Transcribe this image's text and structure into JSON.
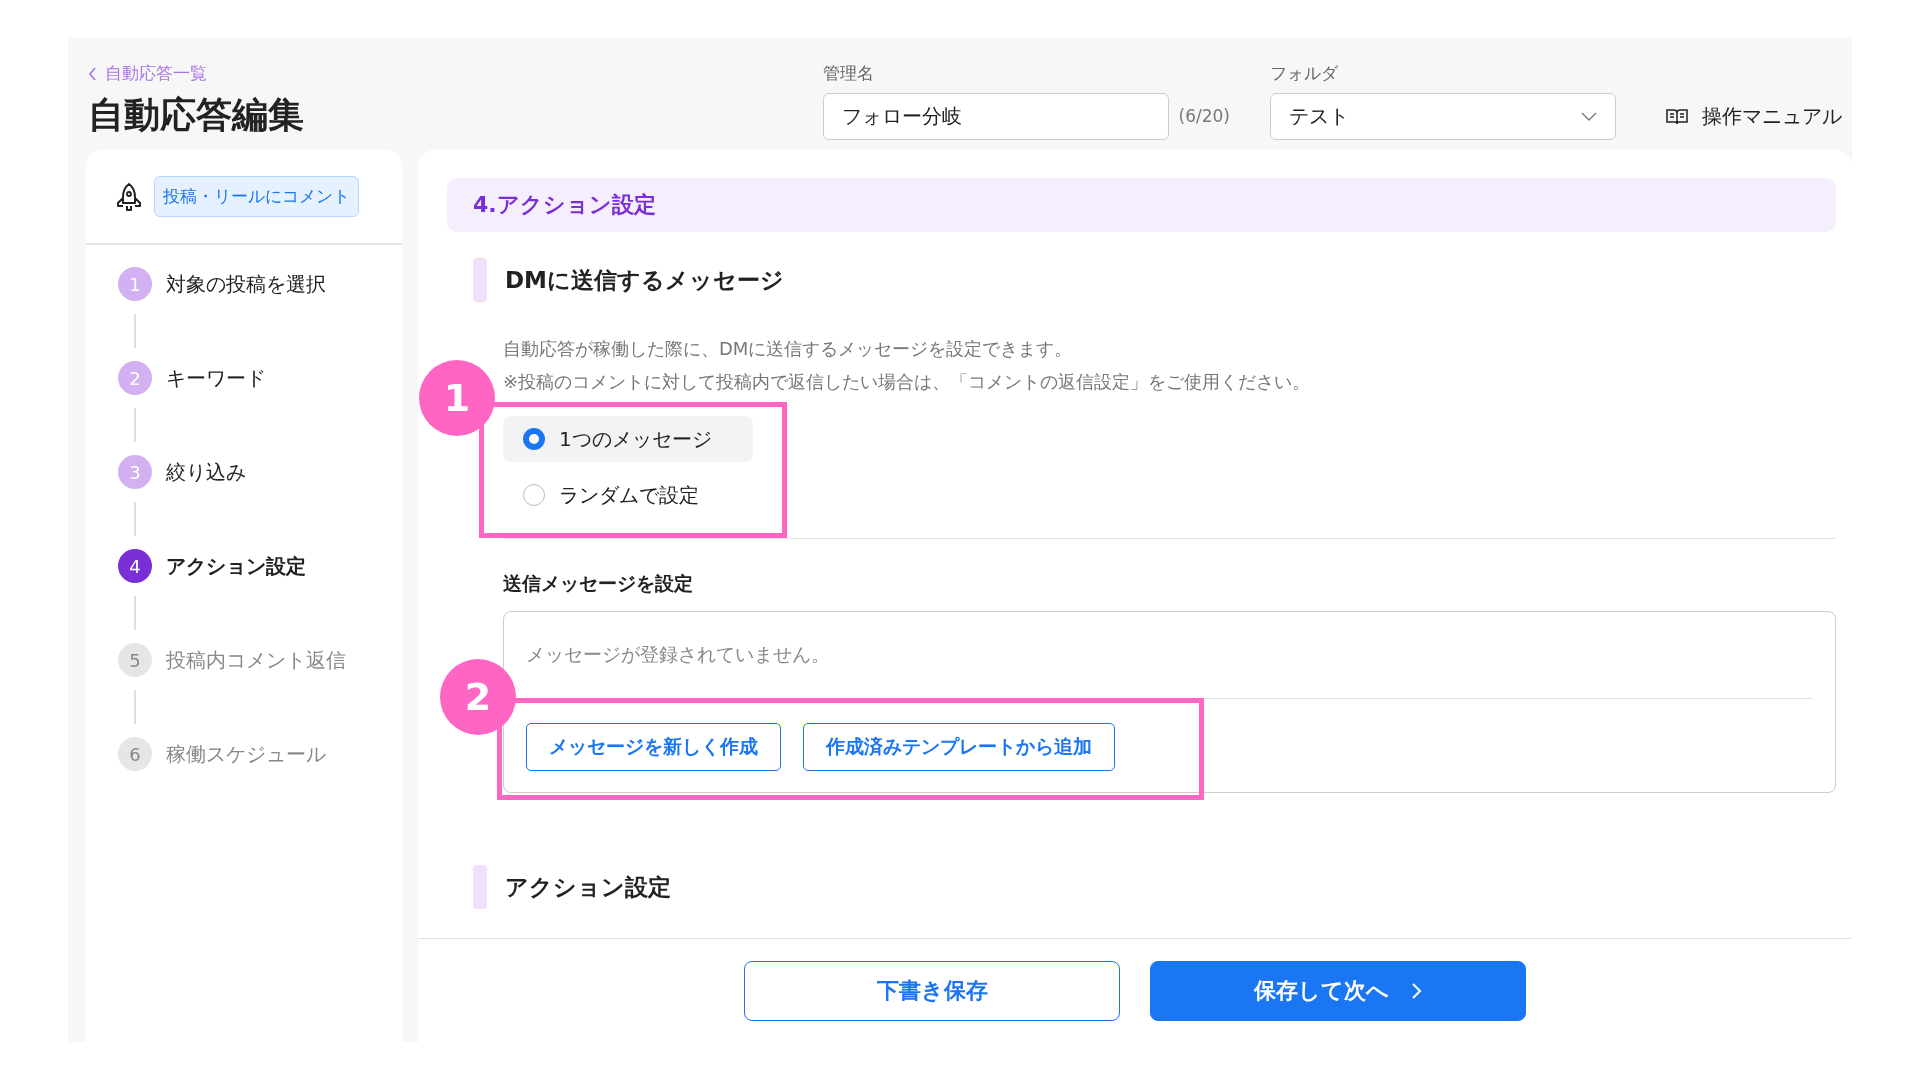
{
  "header": {
    "breadcrumb": "自動応答一覧",
    "title": "自動応答編集",
    "name_field": {
      "label": "管理名",
      "value": "フォロー分岐",
      "counter": "(6/20)"
    },
    "folder_field": {
      "label": "フォルダ",
      "value": "テスト"
    },
    "manual_link": "操作マニュアル"
  },
  "sidebar": {
    "trigger_badge": "投稿・リールにコメント",
    "steps": [
      {
        "number": "1",
        "label": "対象の投稿を選択",
        "kind": "done"
      },
      {
        "number": "2",
        "label": "キーワード",
        "kind": "done"
      },
      {
        "number": "3",
        "label": "絞り込み",
        "kind": "done"
      },
      {
        "number": "4",
        "label": "アクション設定",
        "kind": "current"
      },
      {
        "number": "5",
        "label": "投稿内コメント返信",
        "kind": "upcoming"
      },
      {
        "number": "6",
        "label": "稼働スケジュール",
        "kind": "upcoming"
      }
    ]
  },
  "main": {
    "section_title": "4.アクション設定",
    "dm_heading": "DMに送信するメッセージ",
    "description": [
      "自動応答が稼働した際に、DMに送信するメッセージを設定できます。",
      "※投稿のコメントに対して投稿内で返信したい場合は、「コメントの返信設定」をご使用ください。"
    ],
    "message_mode_options": [
      {
        "label": "1つのメッセージ",
        "selected": true
      },
      {
        "label": "ランダムで設定",
        "selected": false
      }
    ],
    "message_heading": "送信メッセージを設定",
    "message_placeholder": "メッセージが登録されていません。",
    "message_buttons": [
      "メッセージを新しく作成",
      "作成済みテンプレートから追加"
    ],
    "next_heading": "アクション設定"
  },
  "footer": {
    "buttons": [
      {
        "label": "下書き保存",
        "kind": "secondary"
      },
      {
        "label": "保存して次へ",
        "kind": "primary"
      }
    ]
  },
  "callouts": [
    {
      "number": "1"
    },
    {
      "number": "2"
    }
  ]
}
